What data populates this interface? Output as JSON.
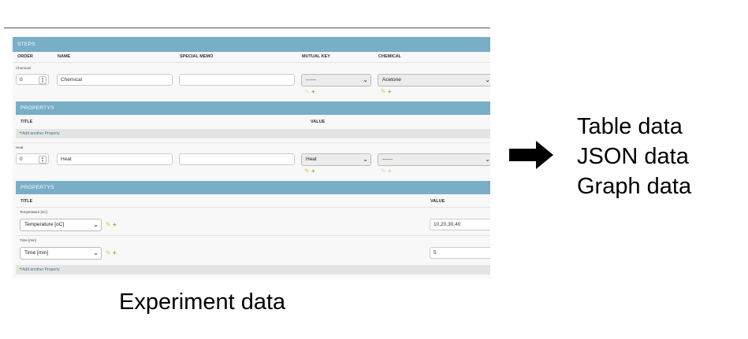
{
  "steps": {
    "title": "STEPS",
    "columns": {
      "order": "ORDER",
      "name": "NAME",
      "memo": "SPECIAL MEMO",
      "mutual_key": "MUTUAL KEY",
      "chemical": "CHEMICAL"
    },
    "rows": [
      {
        "label": "Chemical",
        "order": "0",
        "name": "Chemical",
        "memo": "",
        "mutual_key": "------",
        "chemical": "Acetone"
      },
      {
        "label": "Heat",
        "order": "0",
        "name": "Heat",
        "memo": "",
        "mutual_key": "Heat",
        "chemical": "------"
      }
    ]
  },
  "properties_1": {
    "title": "PROPERTYS",
    "columns": {
      "title": "TITLE",
      "value": "VALUE"
    },
    "add_label": "Add another Property"
  },
  "properties_2": {
    "title": "PROPERTYS",
    "columns": {
      "title": "TITLE",
      "value": "VALUE"
    },
    "rows": [
      {
        "label": "Temperature [oC]",
        "select": "Temperature [oC]",
        "value": "10,20,30,40"
      },
      {
        "label": "Time [min]",
        "select": "Time [min]",
        "value": "5"
      }
    ],
    "add_label": "Add another Property"
  },
  "outputs": [
    "Table data",
    "JSON data",
    "Graph data"
  ],
  "caption": "Experiment data",
  "icons": {
    "arrow": "right-arrow-icon",
    "edit": "pencil-icon",
    "add": "plus-icon",
    "dropdown": "chevron-down-icon",
    "spinner": "spinner-icon"
  },
  "colors": {
    "header": "#79aec8",
    "add_icon": "#70bf2b",
    "edit_icon": "#e7c63a",
    "link": "#417690"
  }
}
